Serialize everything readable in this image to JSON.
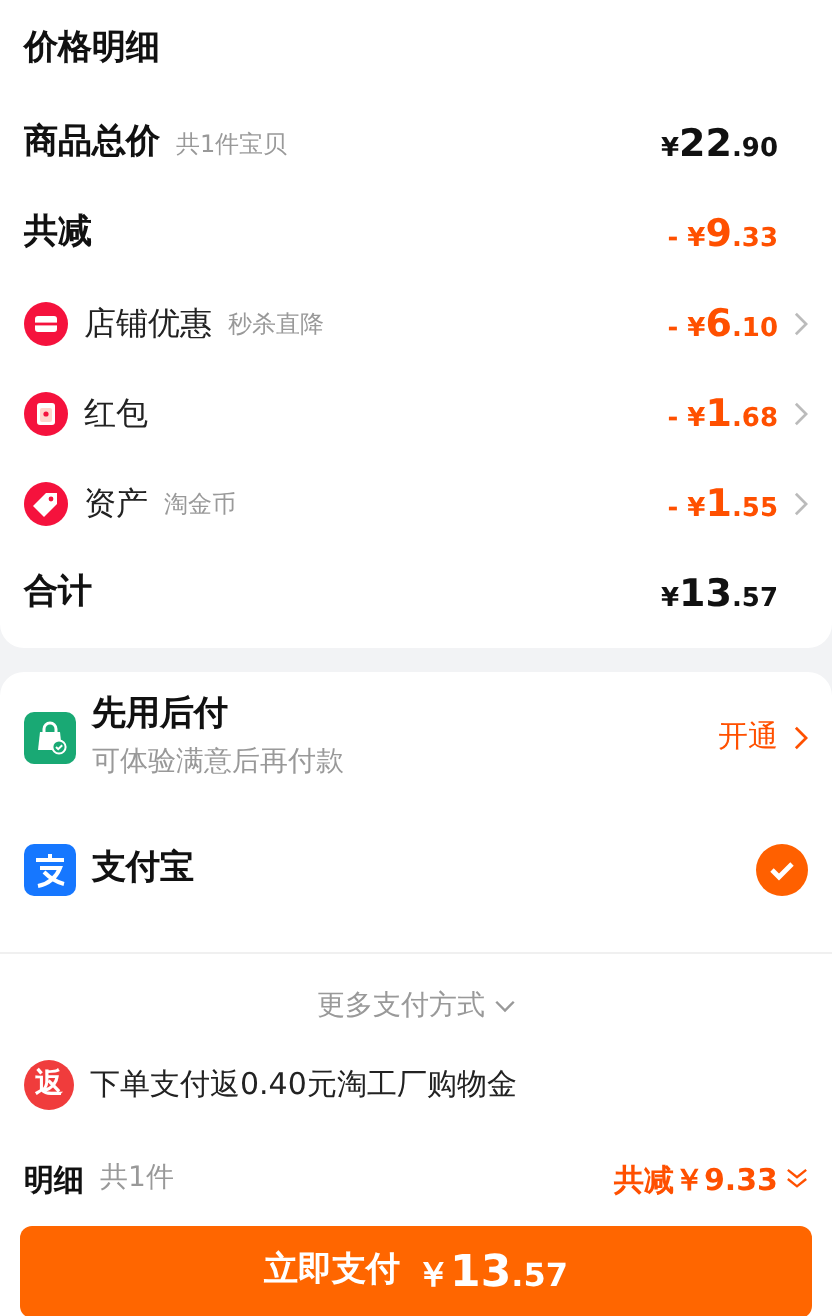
{
  "price_detail": {
    "title": "价格明细",
    "rows": [
      {
        "kind": "subtotal",
        "label": "商品总价",
        "note": "共1件宝贝",
        "prefix": "¥",
        "int": "22",
        "dec": ".90",
        "link": false
      },
      {
        "kind": "discount_total",
        "label": "共减",
        "prefix": "- ¥",
        "int": "9",
        "dec": ".33",
        "link": false
      },
      {
        "kind": "discount",
        "label": "店铺优惠",
        "note": "秒杀直降",
        "prefix": "- ¥",
        "int": "6",
        "dec": ".10",
        "link": true
      },
      {
        "kind": "discount",
        "label": "红包",
        "prefix": "- ¥",
        "int": "1",
        "dec": ".68",
        "link": true
      },
      {
        "kind": "discount",
        "label": "资产",
        "note": "淘金币",
        "prefix": "- ¥",
        "int": "1",
        "dec": ".55",
        "link": true
      },
      {
        "kind": "total",
        "label": "合计",
        "prefix": "¥",
        "int": "13",
        "dec": ".57",
        "link": false
      }
    ]
  },
  "payment": {
    "methods": [
      {
        "title": "先用后付",
        "subtitle": "可体验满意后再付款",
        "action": "开通",
        "selected": false
      },
      {
        "title": "支付宝",
        "selected": true
      }
    ],
    "more": "更多支付方式",
    "promo": {
      "badge": "返",
      "text": "下单支付返0.40元淘工厂购物金"
    }
  },
  "footer": {
    "label": "明细",
    "count": "共1件",
    "discount": "共减￥9.33",
    "pay_button": {
      "label": "立即支付",
      "prefix": "￥",
      "int": "13",
      "dec": ".57"
    }
  }
}
